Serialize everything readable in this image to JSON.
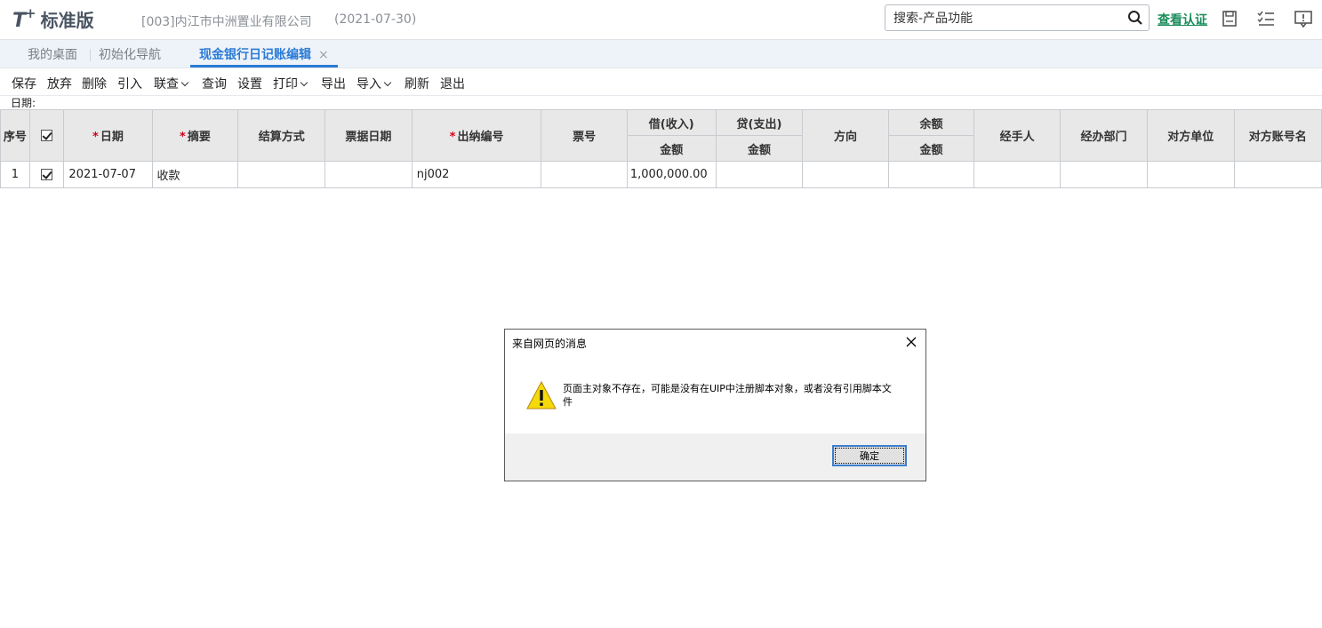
{
  "header": {
    "logo_mark": "T",
    "logo_plus": "+",
    "logo_text": "标准版",
    "company": "[003]内江市中洲置业有限公司",
    "date": "(2021-07-30)",
    "search_placeholder": "搜索-产品功能",
    "verify_link": "查看认证",
    "icons": [
      "search-icon",
      "save-disk-icon",
      "checklist-icon",
      "message-icon"
    ]
  },
  "tabs": [
    {
      "label": "我的桌面",
      "active": false
    },
    {
      "label": "初始化导航",
      "active": false
    },
    {
      "label": "现金银行日记账编辑",
      "active": true,
      "close": "×"
    }
  ],
  "toolbar": [
    {
      "label": "保存",
      "dropdown": false
    },
    {
      "label": "放弃",
      "dropdown": false
    },
    {
      "label": "删除",
      "dropdown": false
    },
    {
      "label": "引入",
      "dropdown": false
    },
    {
      "label": "联查",
      "dropdown": true
    },
    {
      "label": "查询",
      "dropdown": false
    },
    {
      "label": "设置",
      "dropdown": false
    },
    {
      "label": "打印",
      "dropdown": true
    },
    {
      "label": "导出",
      "dropdown": false
    },
    {
      "label": "导入",
      "dropdown": true
    },
    {
      "label": "刷新",
      "dropdown": false
    },
    {
      "label": "退出",
      "dropdown": false
    }
  ],
  "date_label": "日期:",
  "grid": {
    "headers": {
      "seq": "序号",
      "date": "日期",
      "summary": "摘要",
      "settle": "结算方式",
      "bill_date": "票据日期",
      "cashier_no": "出纳编号",
      "bill_no": "票号",
      "debit": "借(收入)",
      "credit": "贷(支出)",
      "direction": "方向",
      "balance": "余额",
      "handler": "经手人",
      "dept": "经办部门",
      "party": "对方单位",
      "party_account": "对方账号名"
    },
    "sub_amount": "金额",
    "required_mark": "*",
    "rows": [
      {
        "seq": "1",
        "checked": true,
        "date": "2021-07-07",
        "summary": "收款",
        "settle": "",
        "bill_date": "",
        "cashier_no": "nj002",
        "bill_no": "",
        "debit": "1,000,000.00",
        "credit": "",
        "direction": "",
        "balance": "",
        "handler": "",
        "dept": "",
        "party": "",
        "party_account": ""
      }
    ]
  },
  "dialog": {
    "title": "来自网页的消息",
    "message": "页面主对象不存在，可能是没有在UIP中注册脚本对象，或者没有引用脚本文件",
    "ok_label": "确定",
    "icon": "warning-icon"
  },
  "colors": {
    "accent_blue": "#2b7bd6",
    "verify_green": "#1a8c5b",
    "required_red": "#d0021b",
    "header_gray": "#e8e8e8",
    "tabbar_bg": "#eef3f9"
  }
}
